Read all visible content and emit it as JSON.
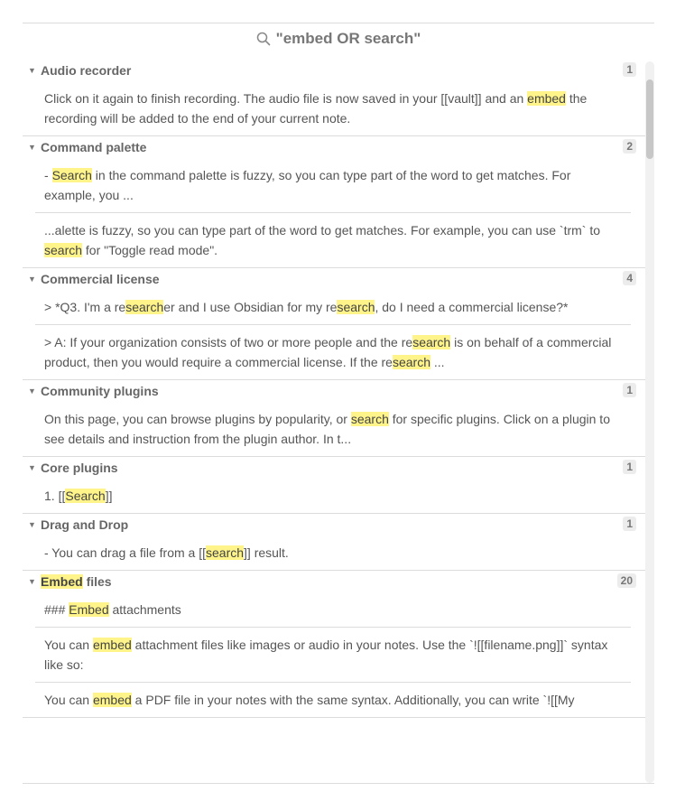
{
  "search": {
    "query": "\"embed OR search\""
  },
  "groups": [
    {
      "name": "Audio recorder",
      "count": "1",
      "matches": [
        [
          {
            "t": "Click on it again to finish recording. The audio file is now saved in your [[vault]] and an "
          },
          {
            "t": "embed",
            "h": true
          },
          {
            "t": " the recording will be added to the end of your current note."
          }
        ]
      ]
    },
    {
      "name": "Command palette",
      "count": "2",
      "matches": [
        [
          {
            "t": "- "
          },
          {
            "t": "Search",
            "h": true
          },
          {
            "t": " in the command palette is fuzzy, so you can type part of the word to get matches. For example, you ..."
          }
        ],
        [
          {
            "t": "...alette is fuzzy, so you can type part of the word to get matches. For example, you can use `trm` to "
          },
          {
            "t": "search",
            "h": true
          },
          {
            "t": " for \"Toggle read mode\"."
          }
        ]
      ]
    },
    {
      "name": "Commercial license",
      "count": "4",
      "matches": [
        [
          {
            "t": "> *Q3. I'm a re"
          },
          {
            "t": "search",
            "h": true
          },
          {
            "t": "er and I use Obsidian for my re"
          },
          {
            "t": "search",
            "h": true
          },
          {
            "t": ", do I need a commercial license?*"
          }
        ],
        [
          {
            "t": "> A: If your organization consists of two or more people and the re"
          },
          {
            "t": "search",
            "h": true
          },
          {
            "t": " is on behalf of a commercial product, then you would require a commercial license. If the re"
          },
          {
            "t": "search",
            "h": true
          },
          {
            "t": " ..."
          }
        ]
      ]
    },
    {
      "name": "Community plugins",
      "count": "1",
      "matches": [
        [
          {
            "t": "On this page, you can browse plugins by popularity, or "
          },
          {
            "t": "search",
            "h": true
          },
          {
            "t": " for specific plugins. Click on a plugin to see details and instruction from the plugin author. In t..."
          }
        ]
      ]
    },
    {
      "name": "Core plugins",
      "count": "1",
      "matches": [
        [
          {
            "t": "1. [["
          },
          {
            "t": "Search",
            "h": true
          },
          {
            "t": "]]"
          }
        ]
      ]
    },
    {
      "name": "Drag and Drop",
      "count": "1",
      "matches": [
        [
          {
            "t": "- You can drag a file from a [["
          },
          {
            "t": "search",
            "h": true
          },
          {
            "t": "]] result."
          }
        ]
      ]
    },
    {
      "name_parts": [
        {
          "t": "Embed",
          "h": true
        },
        {
          "t": " files"
        }
      ],
      "count": "20",
      "matches": [
        [
          {
            "t": "### "
          },
          {
            "t": "Embed",
            "h": true
          },
          {
            "t": " attachments"
          }
        ],
        [
          {
            "t": "You can "
          },
          {
            "t": "embed",
            "h": true
          },
          {
            "t": " attachment files like images or audio in your notes. Use the `![[filename.png]]` syntax like so:"
          }
        ],
        [
          {
            "t": "You can "
          },
          {
            "t": "embed",
            "h": true
          },
          {
            "t": " a PDF file in your notes with the same syntax. Additionally, you can write `![[My"
          }
        ]
      ]
    }
  ]
}
